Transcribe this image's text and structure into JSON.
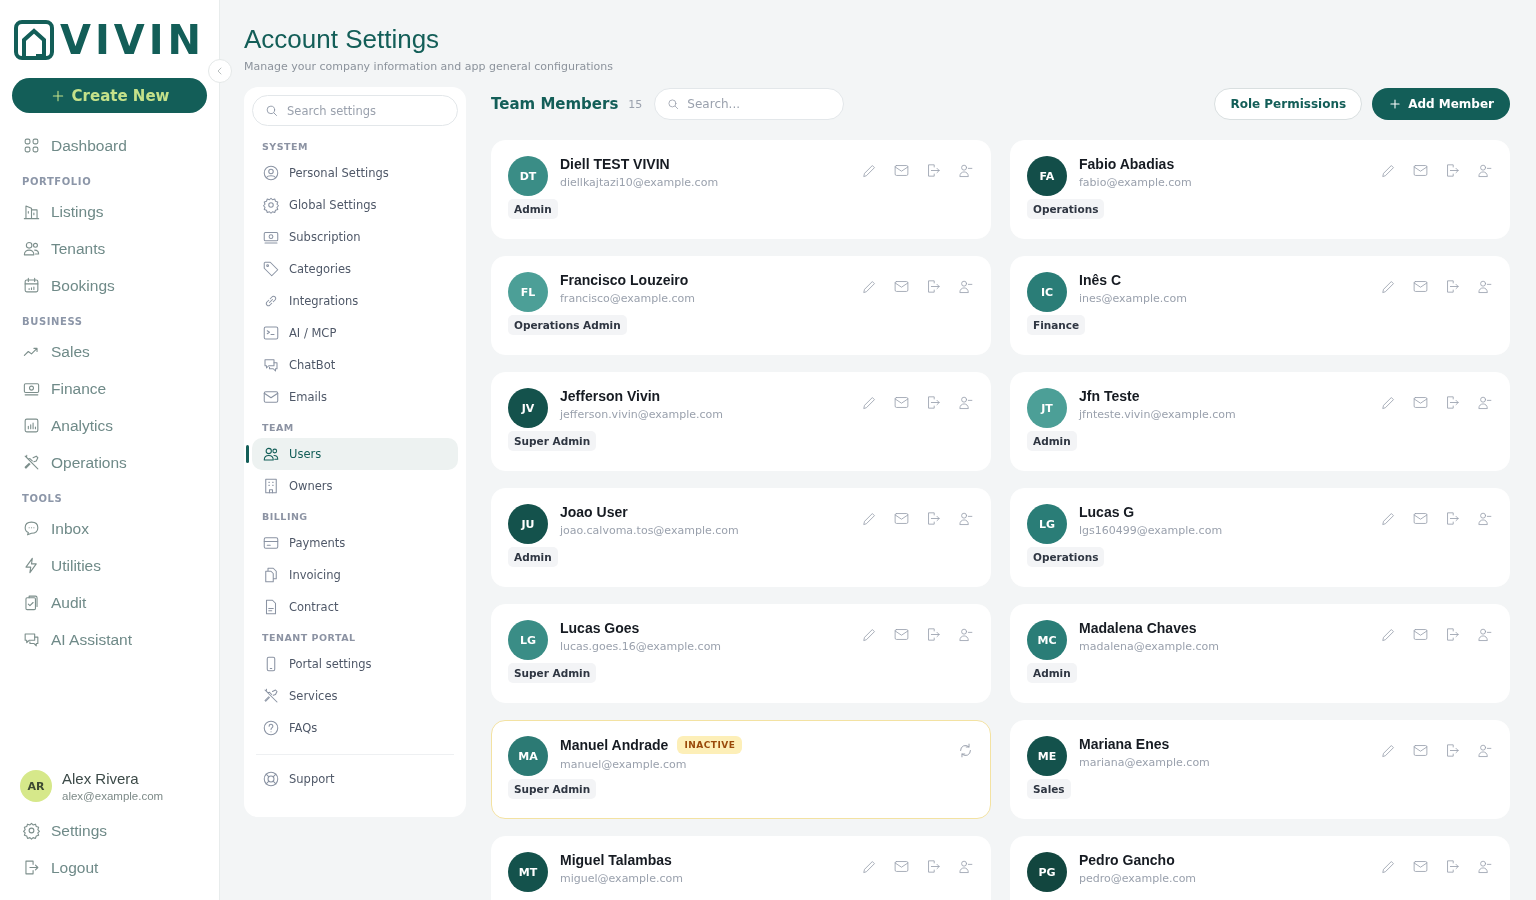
{
  "sidebar": {
    "logo": "VIVIN",
    "create_button": "Create New",
    "sections": [
      {
        "items": [
          {
            "label": "Dashboard",
            "selected": false
          }
        ]
      },
      {
        "heading": "PORTFOLIO",
        "items": [
          {
            "label": "Listings",
            "selected": false
          },
          {
            "label": "Tenants",
            "selected": false
          },
          {
            "label": "Bookings",
            "selected": false
          }
        ]
      },
      {
        "heading": "BUSINESS",
        "items": [
          {
            "label": "Sales",
            "selected": false
          },
          {
            "label": "Finance",
            "selected": false
          },
          {
            "label": "Analytics",
            "selected": false
          },
          {
            "label": "Operations",
            "selected": false
          }
        ]
      },
      {
        "heading": "TOOLS",
        "items": [
          {
            "label": "Inbox",
            "selected": false
          },
          {
            "label": "Utilities",
            "selected": false
          },
          {
            "label": "Audit",
            "selected": false
          },
          {
            "label": "AI Assistant",
            "selected": false
          }
        ]
      }
    ],
    "user": {
      "initials": "AR",
      "name": "Alex Rivera",
      "email": "alex@example.com"
    },
    "footer_items": [
      {
        "label": "Settings"
      },
      {
        "label": "Logout"
      }
    ]
  },
  "header": {
    "title": "Account Settings",
    "subtitle": "Manage your company information and app general configurations"
  },
  "settings_nav": {
    "search_placeholder": "Search settings",
    "sections": [
      {
        "heading": "SYSTEM",
        "items": [
          {
            "label": "Personal Settings",
            "selected": false
          },
          {
            "label": "Global Settings",
            "selected": false
          },
          {
            "label": "Subscription",
            "selected": false
          },
          {
            "label": "Categories",
            "selected": false
          },
          {
            "label": "Integrations",
            "selected": false
          },
          {
            "label": "AI / MCP",
            "selected": false
          },
          {
            "label": "ChatBot",
            "selected": false
          },
          {
            "label": "Emails",
            "selected": false
          }
        ]
      },
      {
        "heading": "TEAM",
        "items": [
          {
            "label": "Users",
            "selected": true
          },
          {
            "label": "Owners",
            "selected": false
          }
        ]
      },
      {
        "heading": "BILLING",
        "items": [
          {
            "label": "Payments",
            "selected": false
          },
          {
            "label": "Invoicing",
            "selected": false
          },
          {
            "label": "Contract",
            "selected": false
          }
        ]
      },
      {
        "heading": "TENANT PORTAL",
        "items": [
          {
            "label": "Portal settings",
            "selected": false
          },
          {
            "label": "Services",
            "selected": false
          },
          {
            "label": "FAQs",
            "selected": false
          }
        ]
      }
    ],
    "footer_item": {
      "label": "Support",
      "selected": false
    }
  },
  "team": {
    "title": "Team Members",
    "count": "15",
    "search_placeholder": "Search...",
    "role_button": "Role Permissions",
    "add_button": "Add Member",
    "members": [
      {
        "initials": "DT",
        "name": "Diell TEST VIVIN",
        "email": "diellkajtazi10@example.com",
        "role": "Admin",
        "color": "#3a8d86",
        "inactive": false
      },
      {
        "initials": "FA",
        "name": "Fabio Abadias",
        "email": "fabio@example.com",
        "role": "Operations",
        "color": "#134e49",
        "inactive": false
      },
      {
        "initials": "FL",
        "name": "Francisco Louzeiro",
        "email": "francisco@example.com",
        "role": "Operations Admin",
        "color": "#4c9f97",
        "inactive": false
      },
      {
        "initials": "IC",
        "name": "Inês C",
        "email": "ines@example.com",
        "role": "Finance",
        "color": "#2a7d77",
        "inactive": false
      },
      {
        "initials": "JV",
        "name": "Jefferson Vivin",
        "email": "jefferson.vivin@example.com",
        "role": "Super Admin",
        "color": "#14524c",
        "inactive": false
      },
      {
        "initials": "JT",
        "name": "Jfn Teste",
        "email": "jfnteste.vivin@example.com",
        "role": "Admin",
        "color": "#4c9f97",
        "inactive": false
      },
      {
        "initials": "JU",
        "name": "Joao User",
        "email": "joao.calvoma.tos@example.com",
        "role": "Admin",
        "color": "#14524c",
        "inactive": false
      },
      {
        "initials": "LG",
        "name": "Lucas G",
        "email": "lgs160499@example.com",
        "role": "Operations",
        "color": "#2a7d77",
        "inactive": false
      },
      {
        "initials": "LG",
        "name": "Lucas Goes",
        "email": "lucas.goes.16@example.com",
        "role": "Super Admin",
        "color": "#3a8d86",
        "inactive": false
      },
      {
        "initials": "MC",
        "name": "Madalena Chaves",
        "email": "madalena@example.com",
        "role": "Admin",
        "color": "#2a7d77",
        "inactive": false
      },
      {
        "initials": "MA",
        "name": "Manuel Andrade",
        "email": "manuel@example.com",
        "role": "Super Admin",
        "color": "#2c7a74",
        "inactive": true,
        "status_label": "INACTIVE"
      },
      {
        "initials": "ME",
        "name": "Mariana Enes",
        "email": "mariana@example.com",
        "role": "Sales",
        "color": "#14524c",
        "inactive": false
      },
      {
        "initials": "MT",
        "name": "Miguel Talambas",
        "email": "miguel@example.com",
        "color": "#14524c",
        "inactive": false
      },
      {
        "initials": "PG",
        "name": "Pedro Gancho",
        "email": "pedro@example.com",
        "color": "#12463f",
        "inactive": false
      }
    ]
  }
}
